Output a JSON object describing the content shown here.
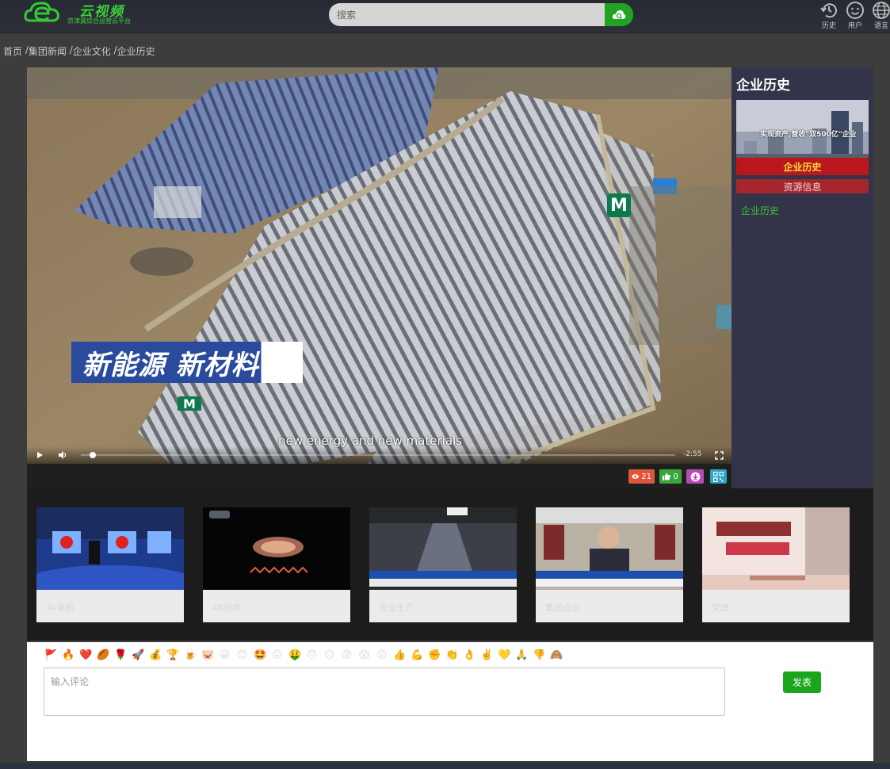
{
  "header": {
    "logo_title": "云视频",
    "logo_subtitle": "京津冀综合运营云平台",
    "search_placeholder": "搜索",
    "tools": [
      {
        "label": "历史",
        "icon": "history-icon"
      },
      {
        "label": "用户",
        "icon": "user-icon"
      },
      {
        "label": "语言",
        "icon": "globe-icon"
      }
    ]
  },
  "breadcrumb": [
    "首页",
    "集团新闻",
    "企业文化",
    "企业历史"
  ],
  "video": {
    "caption": "新能源 新材料",
    "subtitle": "new energy and new materials",
    "logo_mark": "M",
    "time_remaining": "-2:55",
    "progress": 0.01,
    "views": "21",
    "likes": "0"
  },
  "side": {
    "title": "企业历史",
    "thumb_label": "企业历史",
    "thumb_overlay_text": "实现资产,营收\"双500亿\"企业",
    "tab_label": "资源信息",
    "link_label": "企业历史"
  },
  "related": [
    {
      "label": "4k录制"
    },
    {
      "label": "4K视频"
    },
    {
      "label": "安全生产"
    },
    {
      "label": "集团会议"
    },
    {
      "label": "党建"
    }
  ],
  "comments": {
    "emojis": [
      "🚩",
      "🔥",
      "❤️",
      "🏉",
      "🌹",
      "🚀",
      "💰",
      "🏆",
      "🍺",
      "🐷",
      "😀",
      "😊",
      "🤩",
      "😛",
      "🤑",
      "😞",
      "😥",
      "😰",
      "😱",
      "😡",
      "👍",
      "💪",
      "✊",
      "👏",
      "👌",
      "✌️",
      "💛",
      "🙏",
      "👎",
      "🙈"
    ],
    "placeholder": "输入评论",
    "submit_label": "发表"
  },
  "colors": {
    "accent_green": "#1aa51a",
    "side_panel": "#33334a",
    "side_tab": "#a6262d",
    "views_badge": "#e0563b",
    "likes_badge": "#3aa63a",
    "download_badge": "#b84ab8",
    "qr_badge": "#29a5c5"
  }
}
